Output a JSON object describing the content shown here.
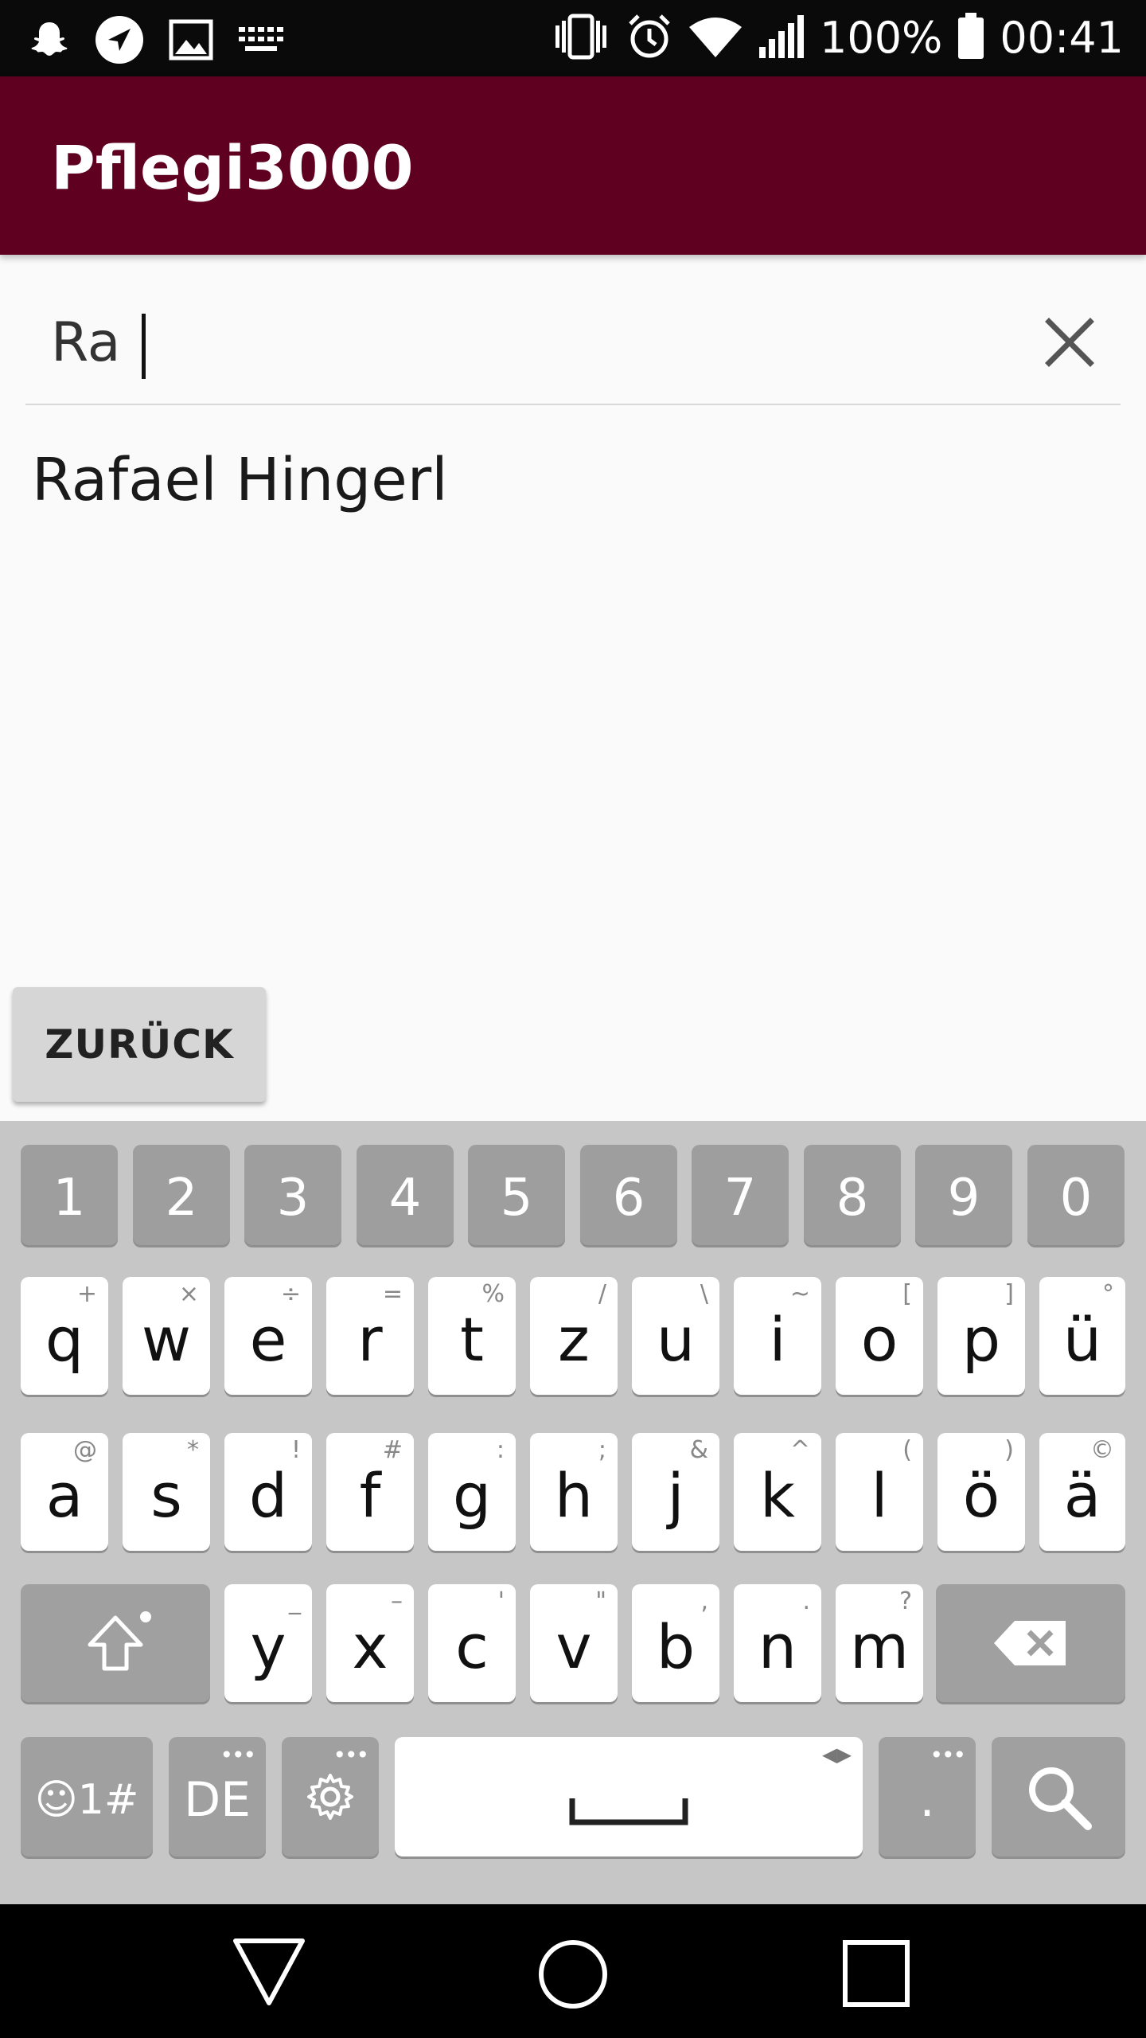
{
  "status_bar": {
    "battery": "100%",
    "time": "00:41",
    "left_icons": [
      "snapchat-icon",
      "location-arrow-icon",
      "image-icon",
      "keyboard-icon"
    ],
    "right_icons": [
      "vibrate-icon",
      "alarm-icon",
      "wifi-icon",
      "signal-icon",
      "battery-icon"
    ]
  },
  "app_bar": {
    "title": "Pflegi3000",
    "color": "#5f0020"
  },
  "search": {
    "value": "Ra",
    "clear_icon": "close-icon"
  },
  "results": [
    "Rafael Hingerl"
  ],
  "back_button": {
    "label": "ZURÜCK"
  },
  "keyboard": {
    "number_row": [
      "1",
      "2",
      "3",
      "4",
      "5",
      "6",
      "7",
      "8",
      "9",
      "0"
    ],
    "row1": [
      {
        "k": "q",
        "s": "+"
      },
      {
        "k": "w",
        "s": "×"
      },
      {
        "k": "e",
        "s": "÷"
      },
      {
        "k": "r",
        "s": "="
      },
      {
        "k": "t",
        "s": "%"
      },
      {
        "k": "z",
        "s": "/"
      },
      {
        "k": "u",
        "s": "\\"
      },
      {
        "k": "i",
        "s": "~"
      },
      {
        "k": "o",
        "s": "["
      },
      {
        "k": "p",
        "s": "]"
      },
      {
        "k": "ü",
        "s": "°"
      }
    ],
    "row2": [
      {
        "k": "a",
        "s": "@"
      },
      {
        "k": "s",
        "s": "*"
      },
      {
        "k": "d",
        "s": "!"
      },
      {
        "k": "f",
        "s": "#"
      },
      {
        "k": "g",
        "s": ":"
      },
      {
        "k": "h",
        "s": ";"
      },
      {
        "k": "j",
        "s": "&"
      },
      {
        "k": "k",
        "s": "^"
      },
      {
        "k": "l",
        "s": "("
      },
      {
        "k": "ö",
        "s": ")"
      },
      {
        "k": "ä",
        "s": "©"
      }
    ],
    "row3": [
      {
        "k": "y",
        "s": "_"
      },
      {
        "k": "x",
        "s": "–"
      },
      {
        "k": "c",
        "s": "'"
      },
      {
        "k": "v",
        "s": "\""
      },
      {
        "k": "b",
        "s": ","
      },
      {
        "k": "n",
        "s": "."
      },
      {
        "k": "m",
        "s": "?"
      }
    ],
    "symbols_key": "☺1#",
    "language_key": "DE",
    "period_key": ".",
    "icons": {
      "shift": "shift-icon",
      "backspace": "backspace-icon",
      "settings": "gear-icon",
      "space": "space-bar-icon",
      "search": "search-icon"
    },
    "accent_colors": {
      "number_key": "#9e9e9e",
      "letter_key": "#ffffff",
      "background": "#c6c6c6"
    }
  },
  "nav_bar": {
    "icons": [
      "back-triangle-icon",
      "home-circle-icon",
      "recents-square-icon"
    ]
  }
}
